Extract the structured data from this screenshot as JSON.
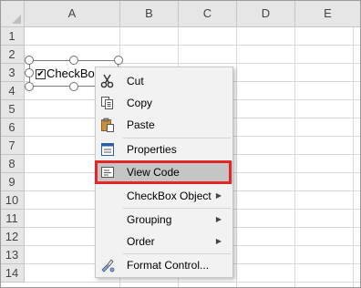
{
  "sheet": {
    "columns": [
      "A",
      "B",
      "C",
      "D",
      "E"
    ],
    "rows": [
      "1",
      "2",
      "3",
      "4",
      "5",
      "6",
      "7",
      "8",
      "9",
      "10",
      "11",
      "12",
      "13",
      "14"
    ]
  },
  "checkbox": {
    "label": "CheckBox",
    "checked_glyph": "✔"
  },
  "context_menu": {
    "items": [
      {
        "label": "Cut",
        "icon": "scissors-icon"
      },
      {
        "label": "Copy",
        "icon": "copy-icon"
      },
      {
        "label": "Paste",
        "icon": "paste-icon"
      },
      {
        "label": "Properties",
        "icon": "properties-icon"
      },
      {
        "label": "View Code",
        "icon": "view-code-icon",
        "highlighted": true
      },
      {
        "label": "CheckBox Object",
        "submenu": true
      },
      {
        "label": "Grouping",
        "submenu": true
      },
      {
        "label": "Order",
        "submenu": true
      },
      {
        "label": "Format Control...",
        "icon": "format-control-icon"
      }
    ],
    "submenu_arrow": "▶"
  },
  "colors": {
    "highlight_border": "#e02828",
    "highlight_bg": "#c5c5c5",
    "header_bg": "#e6e6e6"
  }
}
